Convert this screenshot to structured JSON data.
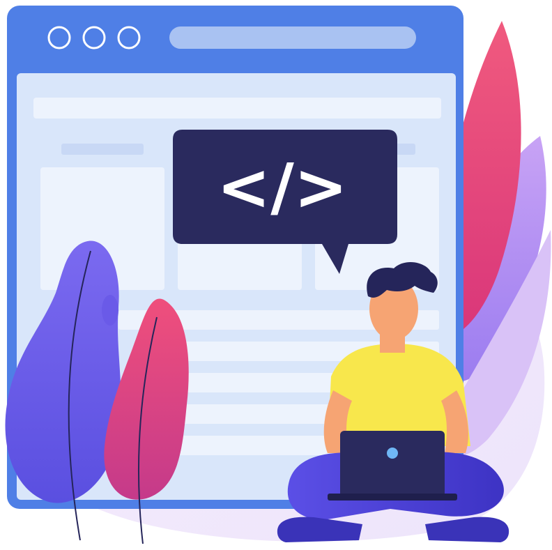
{
  "speech_bubble": {
    "code_symbol": "</>"
  },
  "colors": {
    "browser_frame": "#4f7fe6",
    "browser_header": "#4a73e0",
    "browser_content": "#d9e6fa",
    "content_blocks": "#edf3fd",
    "window_dot_outline": "#ffffff",
    "address_bar": "#a9c2f2",
    "bubble": "#2a2a5e",
    "bubble_text": "#ffffff",
    "leaf_pink": "#e6457a",
    "leaf_violet": "#b48cf0",
    "leaf_purple": "#8a6cf0",
    "background_blob": "#f3ecfb",
    "person_hair": "#25255a",
    "person_skin": "#f6a473",
    "person_shirt": "#f8e74c",
    "person_pants": "#4a3fd4",
    "laptop": "#2a2a5e",
    "laptop_logo": "#6fb6f5"
  },
  "icons": [
    "window-dot-icon",
    "code-symbol-icon",
    "laptop-logo-icon"
  ]
}
